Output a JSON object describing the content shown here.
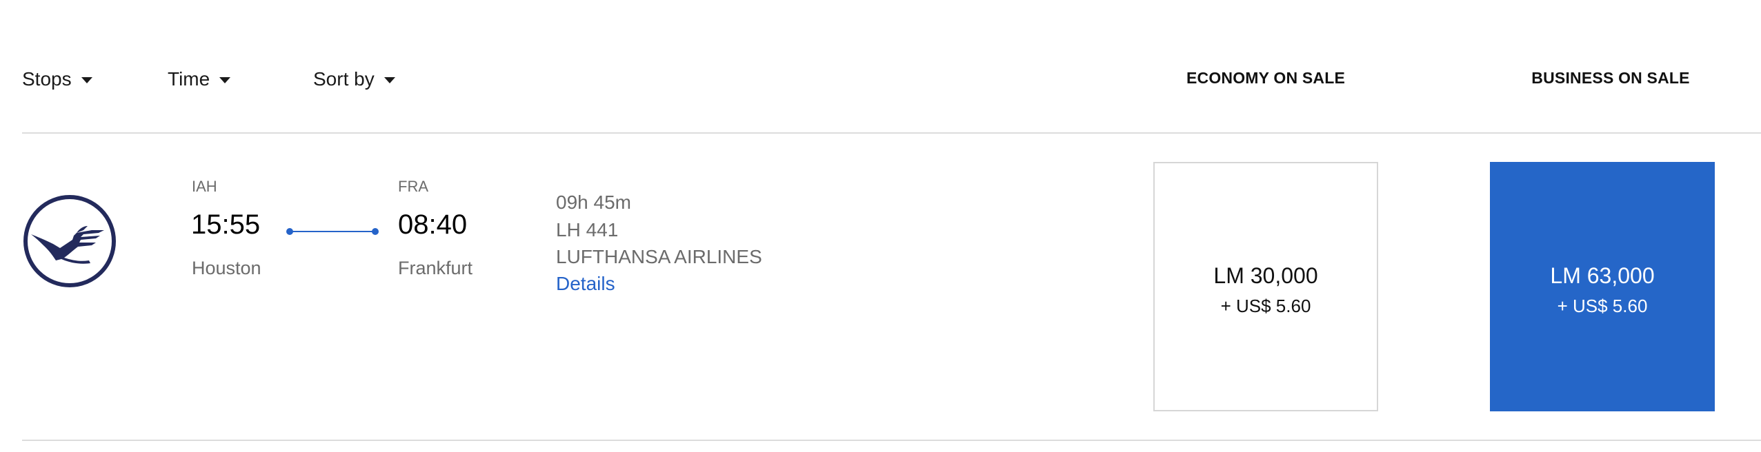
{
  "filters": {
    "stops": "Stops",
    "time": "Time",
    "sort_by": "Sort by"
  },
  "columns": {
    "economy": "ECONOMY ON SALE",
    "business": "BUSINESS ON SALE"
  },
  "flight": {
    "airline_logo_icon": "lufthansa-crane-logo",
    "departure": {
      "code": "IAH",
      "time": "15:55",
      "city": "Houston"
    },
    "arrival": {
      "code": "FRA",
      "time": "08:40",
      "city": "Frankfurt"
    },
    "duration": "09h 45m",
    "flight_number": "LH 441",
    "airline": "LUFTHANSA AIRLINES",
    "details_label": "Details",
    "fares": {
      "economy": {
        "miles": "LM 30,000",
        "fee": "+ US$ 5.60"
      },
      "business": {
        "miles": "LM 63,000",
        "fee": "+ US$ 5.60"
      }
    }
  },
  "colors": {
    "accent": "#2566c8",
    "logo": "#232a5c",
    "muted_text": "#6b6b6b",
    "divider": "#dcdcdc"
  }
}
